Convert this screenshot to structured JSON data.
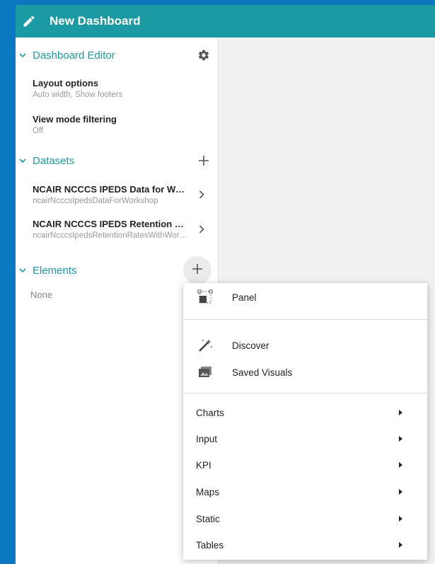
{
  "header": {
    "title": "New Dashboard",
    "edit_icon": "pencil-icon"
  },
  "sidebar": {
    "dashboard_editor": {
      "label": "Dashboard Editor",
      "settings_icon": "gear-icon",
      "items": [
        {
          "title": "Layout options",
          "subtitle": "Auto width, Show footers"
        },
        {
          "title": "View mode filtering",
          "subtitle": "Off"
        }
      ]
    },
    "datasets": {
      "label": "Datasets",
      "add_icon": "plus-icon",
      "items": [
        {
          "title": "NCAIR NCCCS IPEDS Data for Workshop",
          "subtitle": "ncairNcccsIpedsDataForWorkshop"
        },
        {
          "title": "NCAIR NCCCS IPEDS Retention Rates",
          "subtitle": "ncairNcccsIpedsRetentionRatesWithWorkshop"
        }
      ]
    },
    "elements": {
      "label": "Elements",
      "add_icon": "plus-icon",
      "empty_text": "None"
    }
  },
  "add_menu": {
    "panel": {
      "label": "Panel",
      "icon": "panel-icon"
    },
    "discover": {
      "label": "Discover",
      "icon": "magic-wand-icon"
    },
    "saved_visuals": {
      "label": "Saved Visuals",
      "icon": "saved-visuals-icon"
    },
    "submenus": [
      {
        "label": "Charts"
      },
      {
        "label": "Input"
      },
      {
        "label": "KPI"
      },
      {
        "label": "Maps"
      },
      {
        "label": "Static"
      },
      {
        "label": "Tables"
      }
    ]
  },
  "colors": {
    "accent": "#1b9aa3",
    "outer_background": "#0d78c2"
  }
}
